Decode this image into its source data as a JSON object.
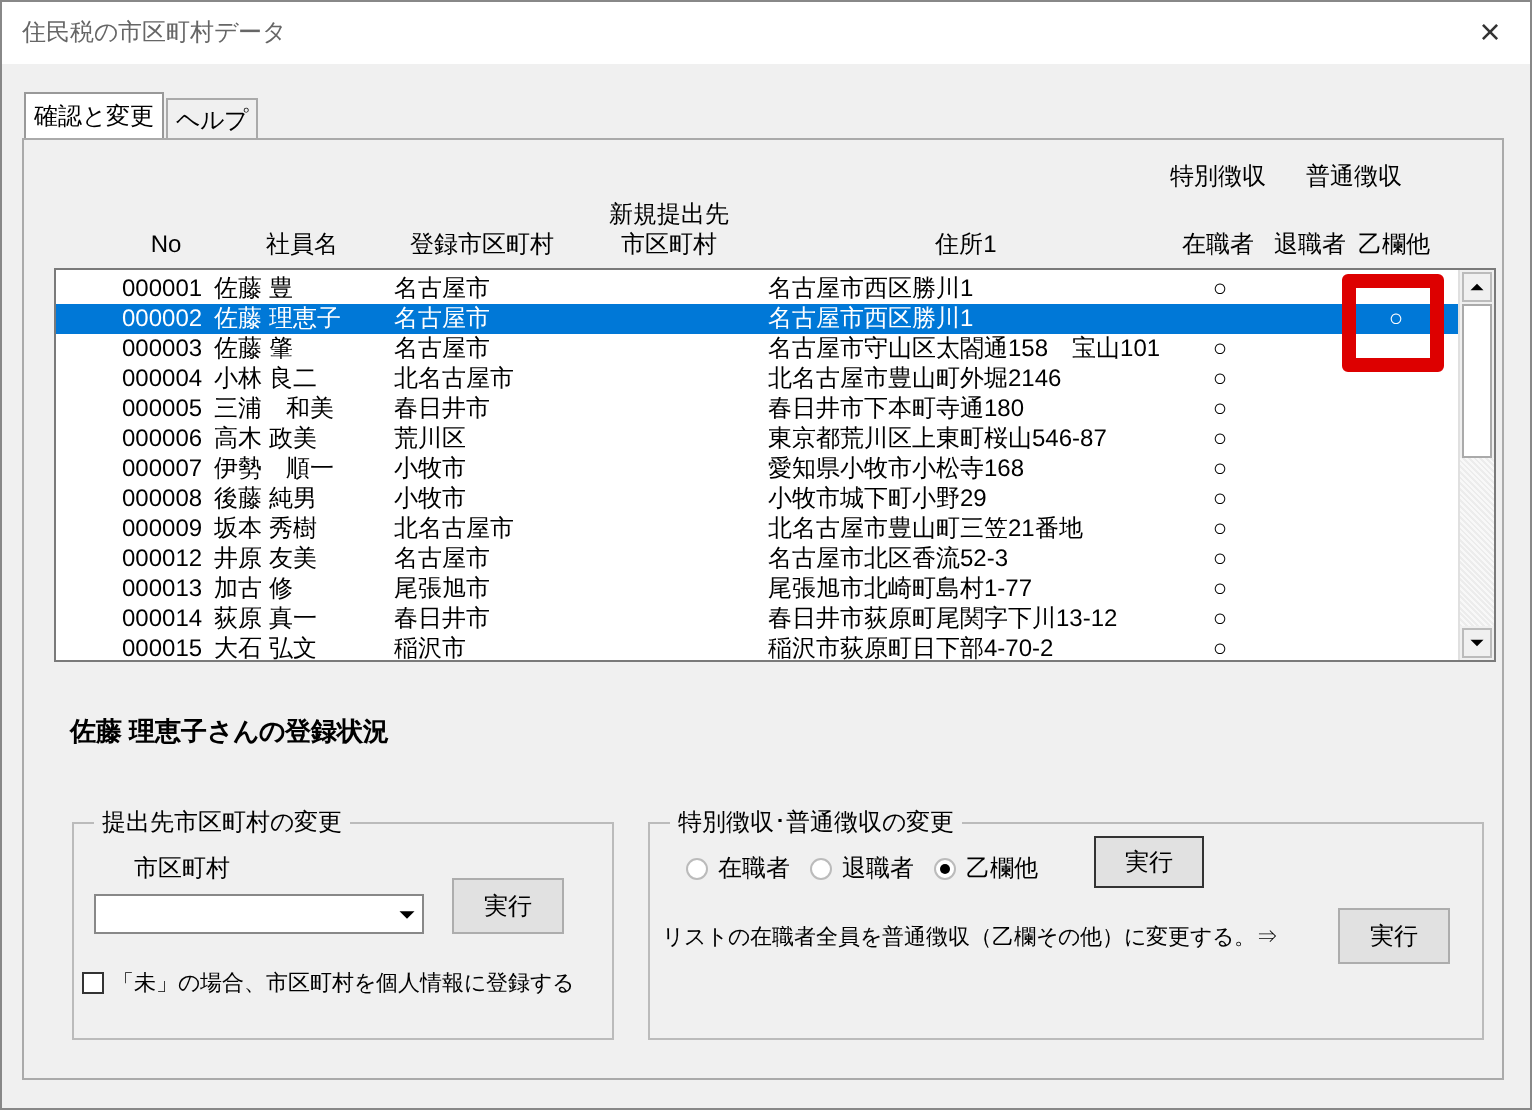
{
  "window": {
    "title": "住民税の市区町村データ",
    "close": "×"
  },
  "tabs": [
    {
      "label": "確認と変更",
      "selected": true
    },
    {
      "label": "ヘルプ",
      "selected": false
    }
  ],
  "list": {
    "group_headers": [
      "特別徴収",
      "普通徴収"
    ],
    "columns": [
      "No",
      "社員名",
      "登録市区町村",
      "新規提出先市区町村",
      "住所1",
      "在職者",
      "退職者",
      "乙欄他"
    ],
    "rows": [
      {
        "no": "000001",
        "name": "佐藤 豊",
        "city": "名古屋市",
        "address": "名古屋市西区勝川1",
        "current": "○",
        "selected": false
      },
      {
        "no": "000002",
        "name": "佐藤 理恵子",
        "city": "名古屋市",
        "address": "名古屋市西区勝川1",
        "other": "○",
        "selected": true
      },
      {
        "no": "000003",
        "name": "佐藤 肇",
        "city": "名古屋市",
        "address": "名古屋市守山区太閤通158　宝山101",
        "current": "○",
        "selected": false
      },
      {
        "no": "000004",
        "name": "小林 良二",
        "city": "北名古屋市",
        "address": "北名古屋市豊山町外堀2146",
        "current": "○",
        "selected": false
      },
      {
        "no": "000005",
        "name": "三浦　和美",
        "city": "春日井市",
        "address": "春日井市下本町寺通180",
        "current": "○",
        "selected": false
      },
      {
        "no": "000006",
        "name": "高木 政美",
        "city": "荒川区",
        "address": "東京都荒川区上東町桜山546-87",
        "current": "○",
        "selected": false
      },
      {
        "no": "000007",
        "name": "伊勢　順一",
        "city": "小牧市",
        "address": "愛知県小牧市小松寺168",
        "current": "○",
        "selected": false
      },
      {
        "no": "000008",
        "name": "後藤 純男",
        "city": "小牧市",
        "address": "小牧市城下町小野29",
        "current": "○",
        "selected": false
      },
      {
        "no": "000009",
        "name": "坂本 秀樹",
        "city": "北名古屋市",
        "address": "北名古屋市豊山町三笠21番地",
        "current": "○",
        "selected": false
      },
      {
        "no": "000012",
        "name": "井原 友美",
        "city": "名古屋市",
        "address": "名古屋市北区香流52-3",
        "current": "○",
        "selected": false
      },
      {
        "no": "000013",
        "name": "加古 修",
        "city": "尾張旭市",
        "address": "尾張旭市北崎町島村1-77",
        "current": "○",
        "selected": false
      },
      {
        "no": "000014",
        "name": "荻原 真一",
        "city": "春日井市",
        "address": "春日井市荻原町尾関字下川13-12",
        "current": "○",
        "selected": false
      },
      {
        "no": "000015",
        "name": "大石 弘文",
        "city": "稲沢市",
        "address": "稲沢市荻原町日下部4-70-2",
        "current": "○",
        "selected": false
      }
    ]
  },
  "status_heading": "佐藤 理恵子さんの登録状況",
  "city_group": {
    "title": "提出先市区町村の変更",
    "field_label": "市区町村",
    "button": "実行",
    "checkbox": {
      "label": "「未」の場合、市区町村を個人情報に登録する",
      "checked": false
    }
  },
  "collection_group": {
    "title": "特別徴収･普通徴収の変更",
    "radios": [
      {
        "label": "在職者",
        "selected": false
      },
      {
        "label": "退職者",
        "selected": false
      },
      {
        "label": "乙欄他",
        "selected": true
      }
    ],
    "button": "実行",
    "bulk_text": "リストの在職者全員を普通徴収（乙欄その他）に変更する。⇒",
    "bulk_button": "実行"
  }
}
